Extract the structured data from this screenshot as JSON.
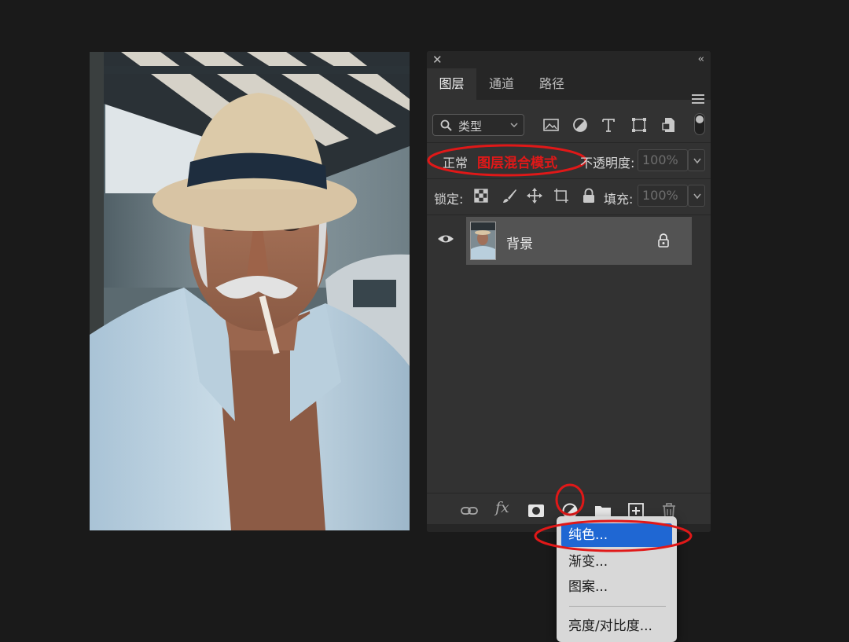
{
  "panel": {
    "close_glyph": "✕",
    "collapse_glyph": "‹‹",
    "tabs": [
      {
        "label": "图层",
        "active": true
      },
      {
        "label": "通道",
        "active": false
      },
      {
        "label": "路径",
        "active": false
      }
    ],
    "menu_icon": "hamburger-icon"
  },
  "filter": {
    "kind_label": "类型",
    "icons": [
      "image-filter-icon",
      "adjustment-filter-icon",
      "type-filter-icon",
      "shape-filter-icon",
      "smart-object-filter-icon"
    ]
  },
  "blend": {
    "mode": "正常",
    "annotation": "图层混合模式",
    "opacity_label": "不透明度:",
    "opacity_value": "100%"
  },
  "lock": {
    "label": "锁定:",
    "icons": [
      "lock-transparent-icon",
      "lock-paint-icon",
      "lock-position-icon",
      "lock-artboard-icon",
      "lock-all-icon"
    ],
    "fill_label": "填充:",
    "fill_value": "100%"
  },
  "layers": [
    {
      "name": "背景",
      "visible": true,
      "locked": true
    }
  ],
  "bottom_bar": {
    "icons": [
      "link-icon",
      "fx-icon",
      "mask-icon",
      "adjustment-layer-icon",
      "group-folder-icon",
      "new-layer-icon",
      "trash-icon"
    ],
    "fx_label": "fx"
  },
  "adjustment_menu": {
    "items": [
      {
        "label": "纯色...",
        "selected": true
      },
      {
        "label": "渐变...",
        "selected": false
      },
      {
        "label": "图案...",
        "selected": false
      },
      {
        "label": "亮度/对比度...",
        "selected": false
      }
    ]
  },
  "colors": {
    "background": "#1a1a1a",
    "panel": "#323232",
    "highlight": "#1f67d3",
    "annotation": "#e01818"
  }
}
